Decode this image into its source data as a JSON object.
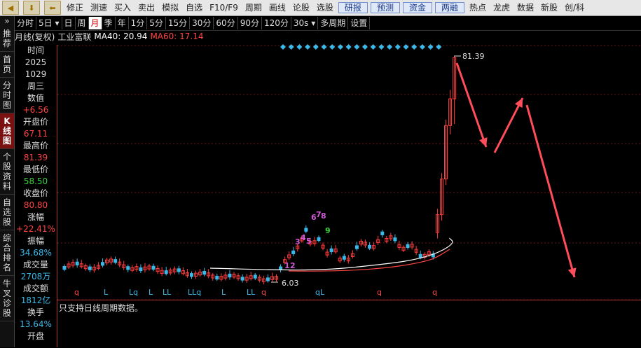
{
  "toolbar": {
    "items": [
      "修正",
      "测速",
      "买入",
      "卖出",
      "模拟",
      "自选",
      "F10/F9",
      "周期",
      "画线",
      "论股",
      "选股"
    ],
    "boxed": [
      "研报",
      "预测",
      "资金",
      "两融"
    ],
    "tail": [
      "热点",
      "龙虎",
      "数据",
      "新股",
      "创/科"
    ]
  },
  "leftnav": {
    "tabs": [
      "推荐",
      "首页",
      "分时图",
      "K线图",
      "个股资料",
      "自选股",
      "综合排名",
      "牛叉诊股"
    ]
  },
  "periodbar": {
    "items": [
      "分时",
      "5日",
      "日",
      "周",
      "月",
      "季",
      "年",
      "1分",
      "5分",
      "15分",
      "30分",
      "60分",
      "90分",
      "120分",
      "30s",
      "多周期",
      "设置"
    ],
    "active": "月"
  },
  "chart_header": {
    "label": "月线(复权)",
    "name": "工业富联",
    "ma40": "MA40: 20.94",
    "ma60": "MA60: 17.14"
  },
  "info_panel": [
    {
      "label": "时间",
      "value": "2025",
      "color": "#ddd"
    },
    {
      "label": "",
      "value": "1029",
      "color": "#ddd"
    },
    {
      "label": "周三",
      "value": "",
      "color": "#ddd"
    },
    {
      "label": "数值",
      "value": "+6.56",
      "color": "#ff4444"
    },
    {
      "label": "开盘价",
      "value": "67.11",
      "color": "#ff4444"
    },
    {
      "label": "最高价",
      "value": "81.39",
      "color": "#ff4444"
    },
    {
      "label": "最低价",
      "value": "58.50",
      "color": "#3cd03c"
    },
    {
      "label": "收盘价",
      "value": "80.80",
      "color": "#ff4444"
    },
    {
      "label": "涨幅",
      "value": "+22.41%",
      "color": "#ff4444"
    },
    {
      "label": "振幅",
      "value": "34.68%",
      "color": "#3ab8e8"
    },
    {
      "label": "成交量",
      "value": "2708万",
      "color": "#3ab8e8"
    },
    {
      "label": "成交额",
      "value": "1812亿",
      "color": "#3ab8e8"
    },
    {
      "label": "换手",
      "value": "13.64%",
      "color": "#3ab8e8"
    },
    {
      "label": "开盘",
      "value": "",
      "color": "#ddd"
    }
  ],
  "bottom": {
    "message": "只支持日线周期数据。"
  },
  "chart_data": {
    "type": "candlestick",
    "high_label": "81.39",
    "low_label": "6.03",
    "bottom_markers": [
      "q",
      "L",
      "Lq",
      "L",
      "LL",
      "LLq",
      "L",
      "LL",
      "q",
      "qL",
      "q",
      "q"
    ],
    "pattern_labels": [
      "1",
      "2",
      "3",
      "4",
      "5",
      "6",
      "7",
      "8",
      "9"
    ],
    "colors": {
      "up": "#ff3b3b",
      "down": "#3ab8e8",
      "ma_white": "#ffffff",
      "ma_red": "#ff4444",
      "diamond": "#3ab8e8",
      "arrow": "#ff4d5a",
      "grid": "#6a1515"
    }
  }
}
